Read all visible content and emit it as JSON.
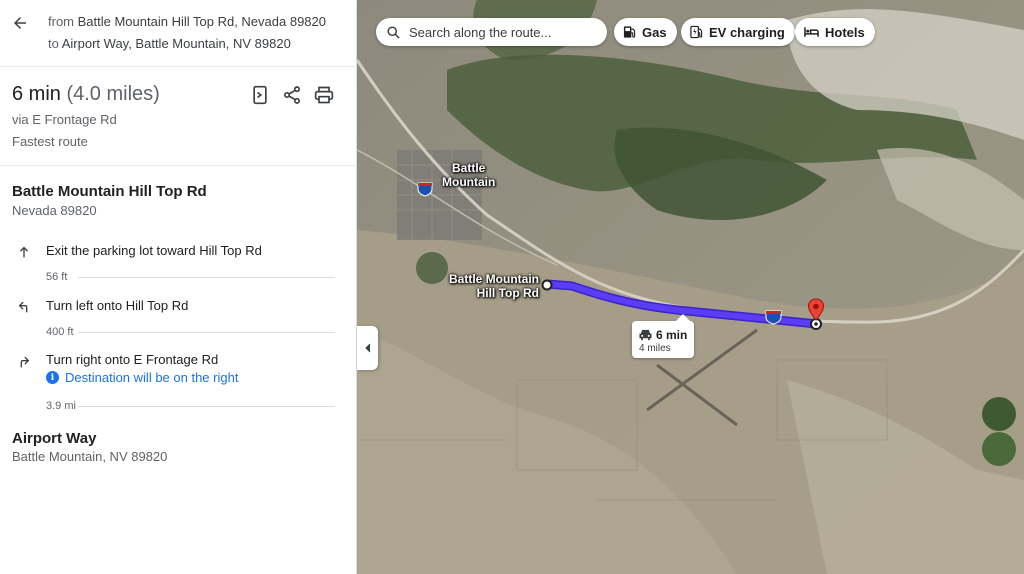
{
  "directions": {
    "from_prefix": "from",
    "from": "Battle Mountain Hill Top Rd, Nevada 89820",
    "to_prefix": "to",
    "to": "Airport Way, Battle Mountain, NV 89820"
  },
  "summary": {
    "duration": "6 min",
    "distance": "(4.0 miles)",
    "via": "via E Frontage Rd",
    "note": "Fastest route"
  },
  "start": {
    "title": "Battle Mountain Hill Top Rd",
    "subtitle": "Nevada 89820"
  },
  "steps": [
    {
      "text": "Exit the parking lot toward Hill Top Rd",
      "distance": "56 ft",
      "icon": "arrow-up-icon"
    },
    {
      "text": "Turn left onto Hill Top Rd",
      "distance": "400 ft",
      "icon": "turn-left-icon"
    },
    {
      "text": "Turn right onto E Frontage Rd",
      "note": "Destination will be on the right",
      "distance": "3.9 mi",
      "icon": "turn-right-icon"
    }
  ],
  "end": {
    "title": "Airport Way",
    "subtitle": "Battle Mountain, NV 89820"
  },
  "search": {
    "placeholder": "Search along the route..."
  },
  "chips": [
    {
      "label": "Gas",
      "icon": "gas-station-icon"
    },
    {
      "label": "EV charging",
      "icon": "ev-charging-icon"
    },
    {
      "label": "Hotels",
      "icon": "hotel-bed-icon"
    }
  ],
  "map": {
    "town_label_1": "Battle",
    "town_label_2": "Mountain",
    "start_label_1": "Battle Mountain",
    "start_label_2": "Hill Top Rd",
    "route_time": "6 min",
    "route_distance": "4 miles",
    "interstate_shield": "80",
    "route_color": "#5b3df5",
    "destination_pin_color": "#ea4335"
  }
}
